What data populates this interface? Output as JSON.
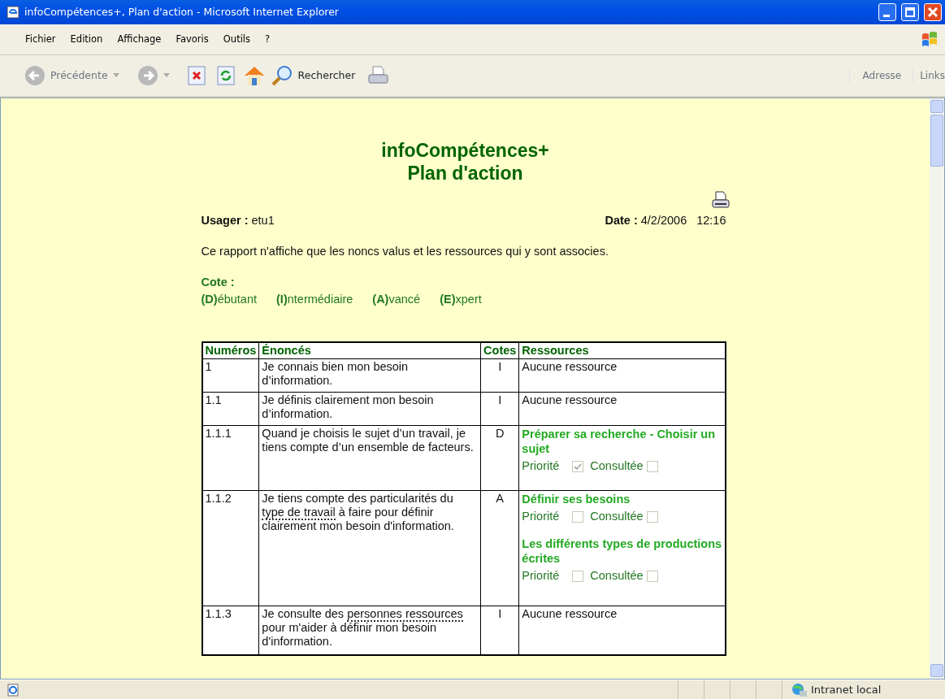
{
  "window": {
    "title": "infoCompétences+, Plan d'action - Microsoft Internet Explorer"
  },
  "menu": [
    "Fichier",
    "Edition",
    "Affichage",
    "Favoris",
    "Outils",
    "?"
  ],
  "toolbar": {
    "back": "Précédente",
    "search": "Rechercher",
    "address": "Adresse",
    "links": "Links"
  },
  "page": {
    "title": "infoCompétences+",
    "subtitle": "Plan d'action",
    "user_label": "Usager :",
    "user": "etu1",
    "date_label": "Date :",
    "date": "4/2/2006",
    "time": "12:16",
    "note": "Ce rapport n'affiche que les noncs valus et les ressources qui y sont associes.",
    "legend_title": "Cote :",
    "legend": [
      {
        "key": "(D)",
        "rest": "ébutant"
      },
      {
        "key": "(I)",
        "rest": "ntermédiaire"
      },
      {
        "key": "(A)",
        "rest": "vancé"
      },
      {
        "key": "(E)",
        "rest": "xpert"
      }
    ]
  },
  "table": {
    "columns": [
      "Numéros",
      "Énoncés",
      "Cotes",
      "Ressources"
    ],
    "rows": [
      {
        "number": "1",
        "statement": [
          {
            "text": "Je connais bien mon besoin d’information.",
            "term": false
          }
        ],
        "rating": "I",
        "empty_text": "Aucune ressource",
        "resources": []
      },
      {
        "number": "1.1",
        "statement": [
          {
            "text": "Je définis clairement mon besoin d’information.",
            "term": false
          }
        ],
        "rating": "I",
        "empty_text": "Aucune ressource",
        "resources": []
      },
      {
        "number": "1.1.1",
        "statement": [
          {
            "text": "Quand je choisis le sujet d’un travail, je tiens compte d’un ensemble de facteurs.",
            "term": false
          }
        ],
        "rating": "D",
        "resources": [
          {
            "title": "Préparer sa recherche - Choisir un sujet",
            "priority_label": "Priorité",
            "priority": true,
            "consulted_label": "Consultée",
            "consulted": false
          }
        ]
      },
      {
        "number": "1.1.2",
        "statement": [
          {
            "text": "Je tiens compte des particularités du ",
            "term": false
          },
          {
            "text": "type de travail",
            "term": true
          },
          {
            "text": " à faire pour définir clairement mon besoin d'information.",
            "term": false
          }
        ],
        "rating": "A",
        "resources": [
          {
            "title": "Définir ses besoins",
            "priority_label": "Priorité",
            "priority": false,
            "consulted_label": "Consultée",
            "consulted": false
          },
          {
            "title": "Les différents types de productions écrites",
            "priority_label": "Priorité",
            "priority": false,
            "consulted_label": "Consultée",
            "consulted": false
          }
        ]
      },
      {
        "number": "1.1.3",
        "statement": [
          {
            "text": "Je consulte des ",
            "term": false
          },
          {
            "text": "personnes ressources",
            "term": true
          },
          {
            "text": " pour m'aider à définir mon besoin d'information.",
            "term": false
          }
        ],
        "rating": "I",
        "empty_text": "Aucune ressource",
        "resources": []
      }
    ]
  },
  "status_bar": {
    "zone": "Intranet local"
  }
}
